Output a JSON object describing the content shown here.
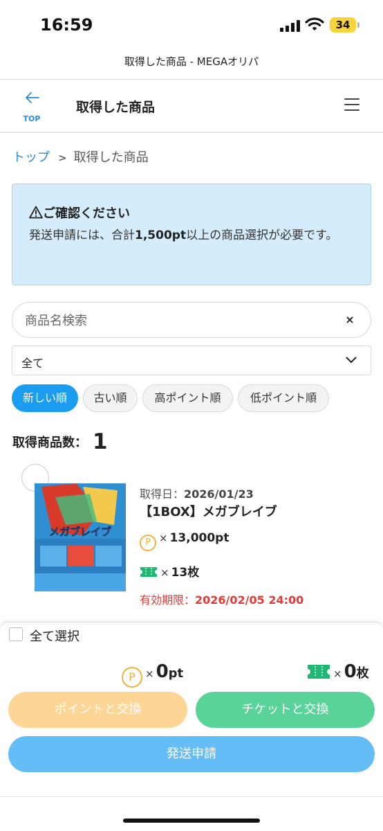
{
  "status_bar": {
    "time": "16:59",
    "battery": "34",
    "battery_color": "#f6d43a"
  },
  "browser": {
    "title": "取得した商品 - MEGAオリパ"
  },
  "header": {
    "back_label": "TOP",
    "title": "取得した商品",
    "back_icon": "arrow-left-icon",
    "menu_icon": "hamburger-menu-icon"
  },
  "breadcrumb": {
    "home": "トップ",
    "separator": ">",
    "current": "取得した商品"
  },
  "notice": {
    "heading": "ご確認ください",
    "body_prefix": "発送申請には、合計",
    "body_amount": "1,500pt",
    "body_suffix": "以上の商品選択が必要です。",
    "icon": "warning-icon",
    "background": "#d4ecfb"
  },
  "search": {
    "placeholder": "商品名検索",
    "value": "",
    "clear": "×"
  },
  "filter": {
    "selected": "全て"
  },
  "sort": {
    "tabs": [
      "新しい順",
      "古い順",
      "高ポイント順",
      "低ポイント順"
    ],
    "active_index": 0,
    "active_color": "#1a9cf0"
  },
  "count": {
    "label": "取得商品数：",
    "value": "1"
  },
  "items": [
    {
      "date_label": "取得日：",
      "date": "2026/01/23",
      "name": "【1BOX】メガブレイブ",
      "coin_symbol": "P",
      "points": "13,000pt",
      "tickets": "13枚",
      "times": "×",
      "expiry_label": "有効期限：",
      "expiry": "2026/02/05 24:00",
      "image_label": "メガブレイブ",
      "expiry_color": "#e53935"
    }
  ],
  "footer": {
    "select_all": "全て選択",
    "times": "×",
    "coin_symbol": "P",
    "points_value": "0",
    "points_unit": "pt",
    "tickets_value": "0",
    "tickets_unit": "枚",
    "btn_points": "ポイントと交換",
    "btn_ticket": "チケットと交換",
    "btn_ship": "発送申請",
    "btn_points_color": "#fdd595",
    "btn_ticket_color": "#5ad39a",
    "btn_ship_color": "#65bdf8"
  }
}
